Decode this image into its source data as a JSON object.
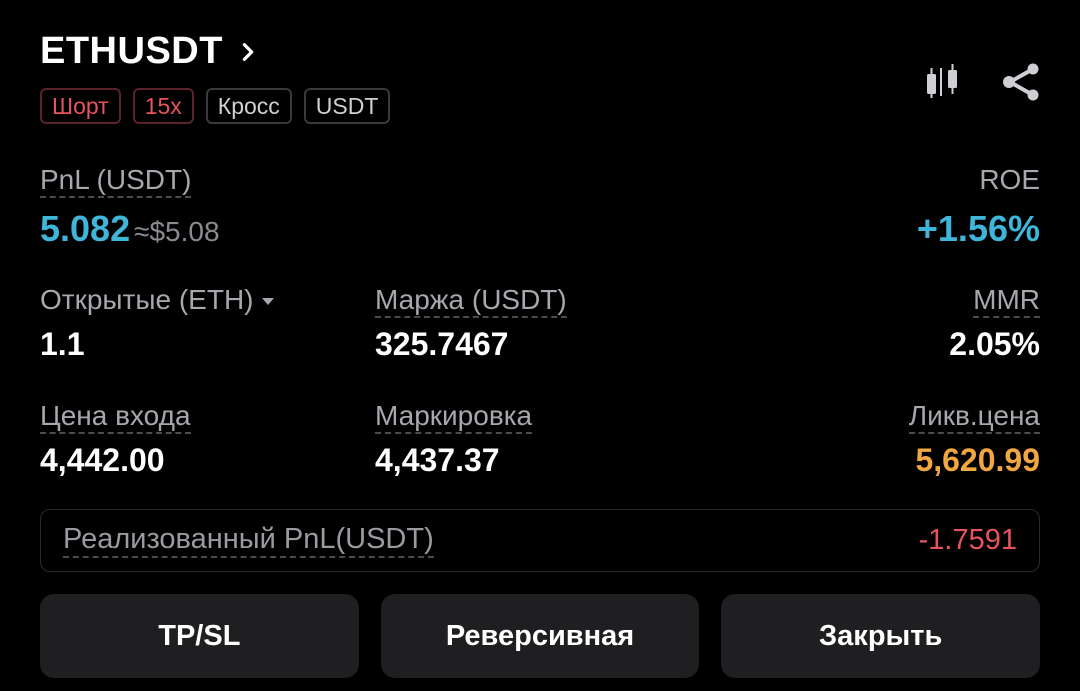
{
  "header": {
    "symbol": "ETHUSDT",
    "tags": [
      "Шорт",
      "15x",
      "Кросс",
      "USDT"
    ]
  },
  "icons": {
    "chart": "candlestick-icon",
    "share": "share-icon",
    "chevron": "chevron-right-icon"
  },
  "pnl": {
    "label": "PnL (USDT)",
    "value": "5.082",
    "approx": "≈$5.08",
    "roe_label": "ROE",
    "roe_value": "+1.56%"
  },
  "stats": {
    "open_label": "Открытые (ETH)",
    "open_value": "1.1",
    "margin_label": "Маржа (USDT)",
    "margin_value": "325.7467",
    "mmr_label": "MMR",
    "mmr_value": "2.05%",
    "entry_label": "Цена входа",
    "entry_value": "4,442.00",
    "mark_label": "Маркировка",
    "mark_value": "4,437.37",
    "liq_label": "Ликв.цена",
    "liq_value": "5,620.99"
  },
  "realized": {
    "label": "Реализованный PnL(USDT)",
    "value": "-1.7591"
  },
  "buttons": {
    "tpsl": "TP/SL",
    "reverse": "Реверсивная",
    "close": "Закрыть"
  },
  "colors": {
    "positive": "#3fb6d9",
    "negative": "#e5535e",
    "liquidation": "#f0a742"
  }
}
